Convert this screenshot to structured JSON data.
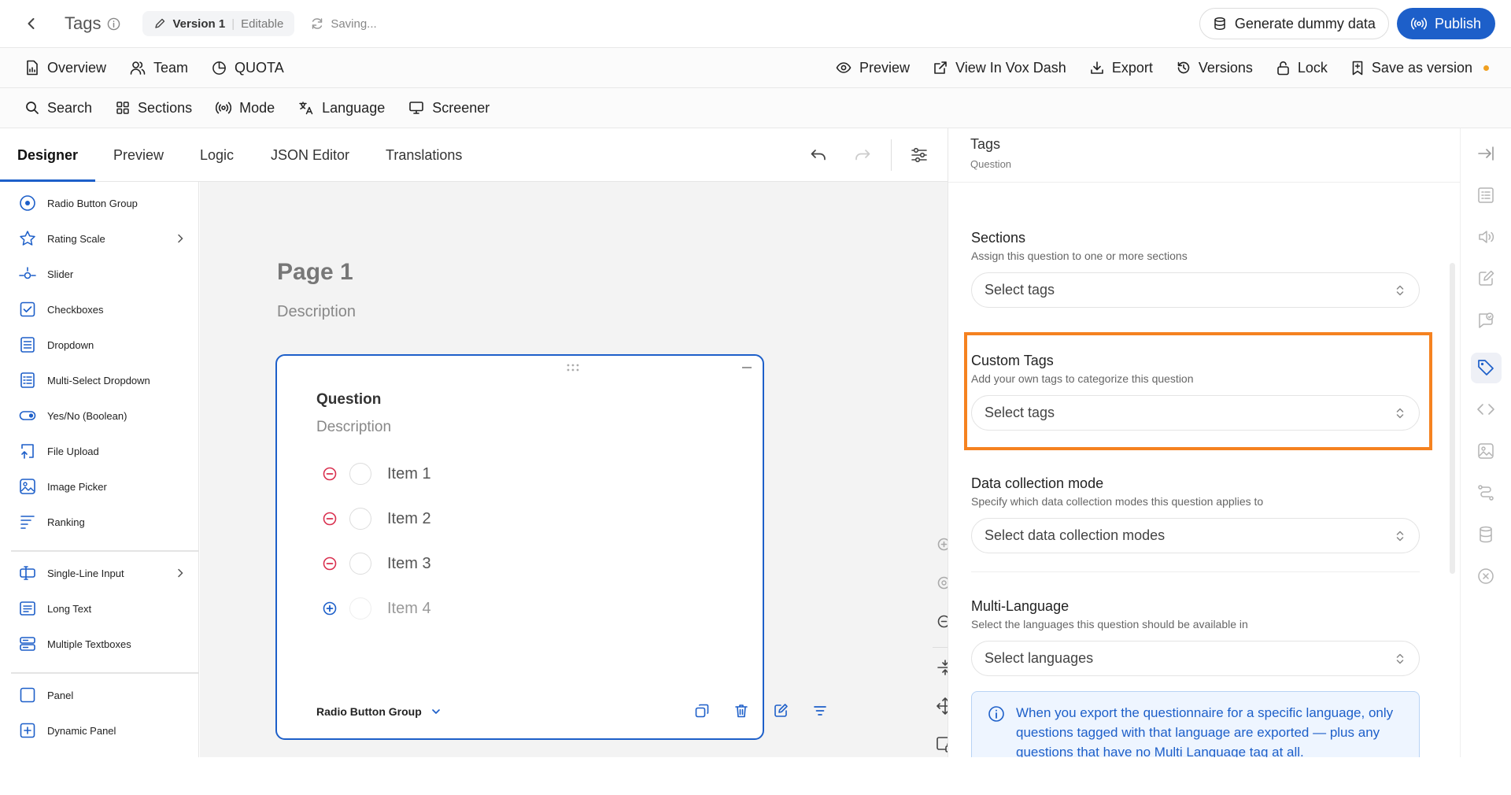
{
  "topbar": {
    "title": "Tags",
    "version_label": "Version 1",
    "version_state": "Editable",
    "status": "Saving...",
    "generate_label": "Generate dummy data",
    "publish_label": "Publish"
  },
  "nav": {
    "left": [
      {
        "label": "Overview",
        "icon": "file-chart-icon"
      },
      {
        "label": "Team",
        "icon": "users-icon"
      },
      {
        "label": "QUOTA",
        "icon": "pie-chart-icon"
      }
    ],
    "right": [
      {
        "label": "Preview",
        "icon": "eye-icon"
      },
      {
        "label": "View In Vox Dash",
        "icon": "external-link-icon"
      },
      {
        "label": "Export",
        "icon": "download-icon"
      },
      {
        "label": "Versions",
        "icon": "history-icon"
      },
      {
        "label": "Lock",
        "icon": "lock-icon"
      },
      {
        "label": "Save as version",
        "icon": "bookmark-icon"
      }
    ]
  },
  "tools": [
    {
      "label": "Search",
      "icon": "search-icon"
    },
    {
      "label": "Sections",
      "icon": "grid-icon"
    },
    {
      "label": "Mode",
      "icon": "broadcast-icon"
    },
    {
      "label": "Language",
      "icon": "translate-icon"
    },
    {
      "label": "Screener",
      "icon": "monitor-icon"
    }
  ],
  "designer_tabs": [
    "Designer",
    "Preview",
    "Logic",
    "JSON Editor",
    "Translations"
  ],
  "toolbox": [
    {
      "label": "Radio Button Group",
      "icon": "radio-icon"
    },
    {
      "label": "Rating Scale",
      "icon": "star-icon"
    },
    {
      "label": "Slider",
      "icon": "slider-icon"
    },
    {
      "label": "Checkboxes",
      "icon": "checkbox-icon"
    },
    {
      "label": "Dropdown",
      "icon": "dropdown-icon"
    },
    {
      "label": "Multi-Select Dropdown",
      "icon": "list-icon"
    },
    {
      "label": "Yes/No (Boolean)",
      "icon": "toggle-icon"
    },
    {
      "label": "File Upload",
      "icon": "upload-icon"
    },
    {
      "label": "Image Picker",
      "icon": "image-icon"
    },
    {
      "label": "Ranking",
      "icon": "ranking-icon"
    },
    {
      "label": "Single-Line Input",
      "icon": "text-cursor-icon"
    },
    {
      "label": "Long Text",
      "icon": "long-text-icon"
    },
    {
      "label": "Multiple Textboxes",
      "icon": "textboxes-icon"
    },
    {
      "label": "Panel",
      "icon": "panel-icon"
    },
    {
      "label": "Dynamic Panel",
      "icon": "dynamic-panel-icon"
    }
  ],
  "page": {
    "title": "Page 1",
    "description": "Description"
  },
  "question": {
    "title": "Question",
    "description": "Description",
    "items": [
      "Item 1",
      "Item 2",
      "Item 3"
    ],
    "add_item": "Item 4",
    "type_label": "Radio Button Group"
  },
  "panel": {
    "title": "Tags",
    "subtitle": "Question",
    "sections": {
      "title": "Sections",
      "subtitle": "Assign this question to one or more sections",
      "placeholder": "Select tags"
    },
    "custom_tags": {
      "title": "Custom Tags",
      "subtitle": "Add your own tags to categorize this question",
      "placeholder": "Select tags"
    },
    "data_collection": {
      "title": "Data collection mode",
      "subtitle": "Specify which data collection modes this question applies to",
      "placeholder": "Select data collection modes"
    },
    "multi_language": {
      "title": "Multi-Language",
      "subtitle": "Select the languages this question should be available in",
      "placeholder": "Select languages"
    },
    "info_text": "When you export the questionnaire for a specific language, only questions tagged with that language are exported — plus any questions that have no Multi Language tag at all."
  },
  "colors": {
    "primary": "#1d5fc9",
    "highlight": "#f58220",
    "remove": "#d9304f"
  }
}
